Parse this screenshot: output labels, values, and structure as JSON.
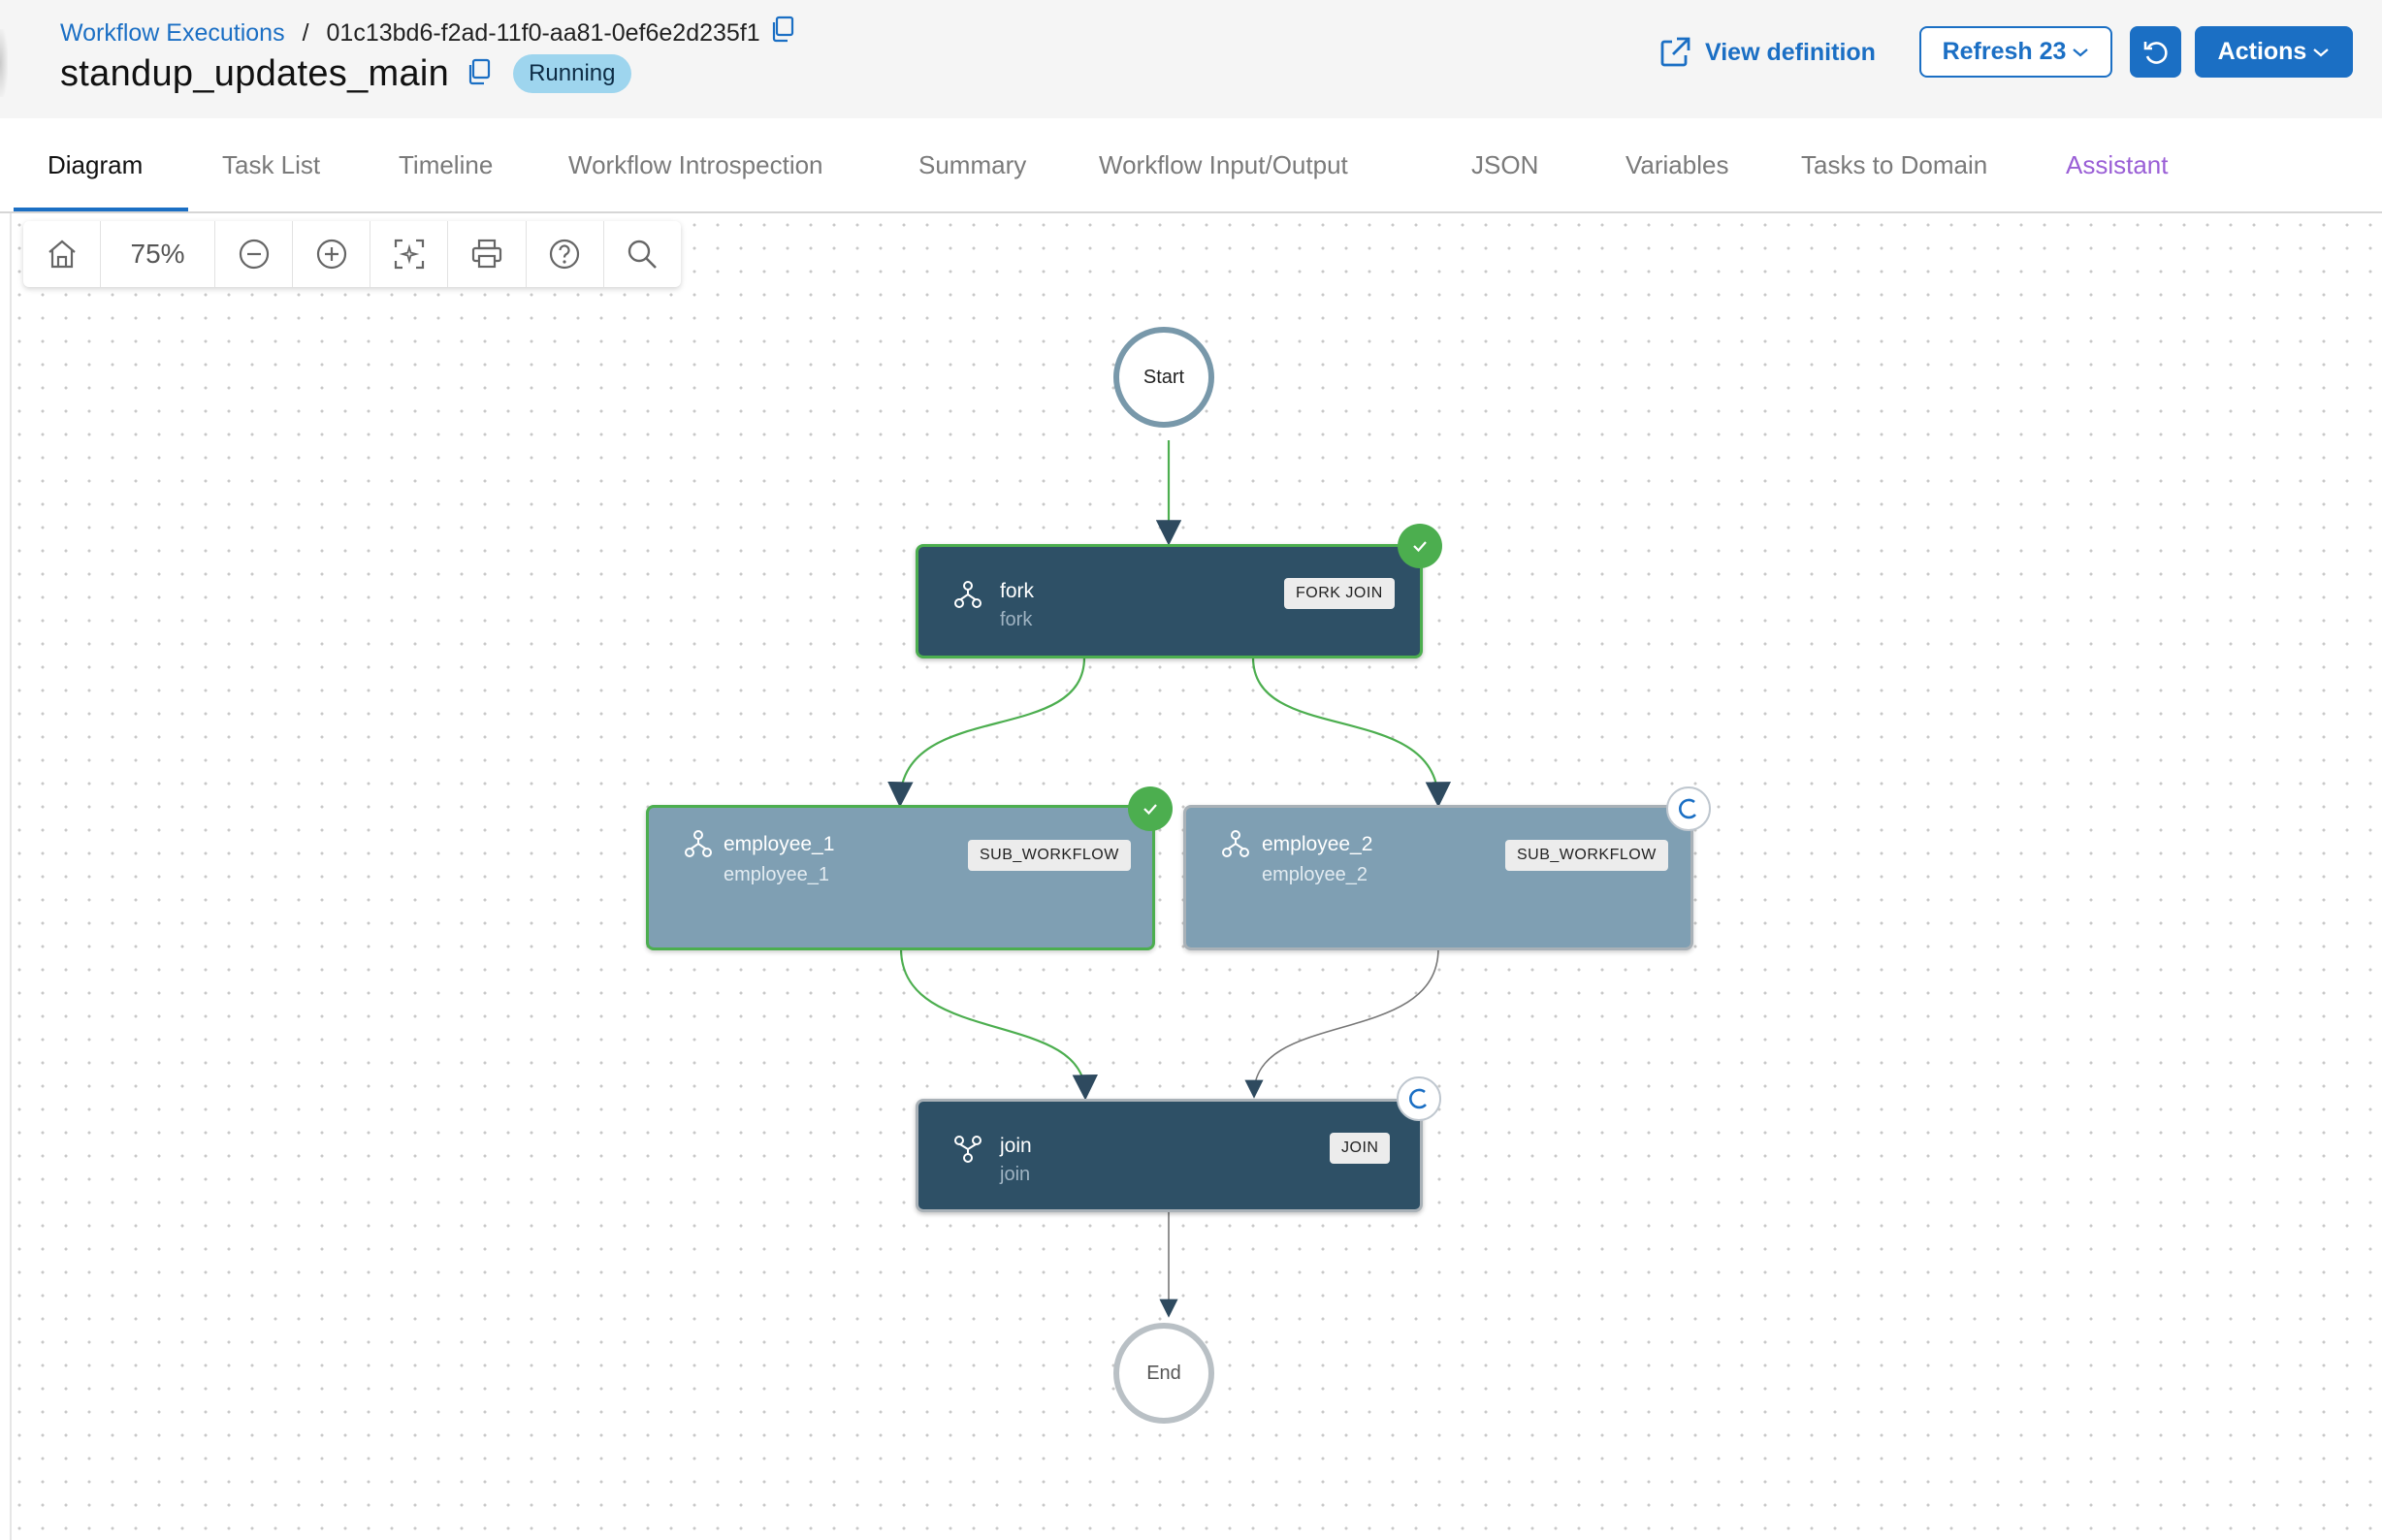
{
  "header": {
    "breadcrumb_link": "Workflow Executions",
    "breadcrumb_separator": "/",
    "execution_id": "01c13bd6-f2ad-11f0-aa81-0ef6e2d235f1",
    "title": "standup_updates_main",
    "status": "Running",
    "view_definition": "View definition",
    "refresh_label": "Refresh 23",
    "actions_label": "Actions"
  },
  "tabs": [
    {
      "label": "Diagram",
      "active": true
    },
    {
      "label": "Task List"
    },
    {
      "label": "Timeline"
    },
    {
      "label": "Workflow Introspection"
    },
    {
      "label": "Summary"
    },
    {
      "label": "Workflow Input/Output"
    },
    {
      "label": "JSON"
    },
    {
      "label": "Variables"
    },
    {
      "label": "Tasks to Domain"
    },
    {
      "label": "Assistant"
    }
  ],
  "toolbar": {
    "zoom": "75%",
    "icons": [
      "home-icon",
      "zoom-out-icon",
      "zoom-in-icon",
      "fit-view-icon",
      "print-icon",
      "help-icon",
      "search-icon"
    ]
  },
  "diagram": {
    "start_label": "Start",
    "end_label": "End",
    "nodes": [
      {
        "name": "fork",
        "ref": "fork",
        "type": "FORK JOIN",
        "status": "completed"
      },
      {
        "name": "employee_1",
        "ref": "employee_1",
        "type": "SUB_WORKFLOW",
        "status": "completed"
      },
      {
        "name": "employee_2",
        "ref": "employee_2",
        "type": "SUB_WORKFLOW",
        "status": "in-progress"
      },
      {
        "name": "join",
        "ref": "join",
        "type": "JOIN",
        "status": "in-progress"
      }
    ]
  },
  "colors": {
    "accent": "#1b6fc4",
    "success": "#4cae4f",
    "node_dark": "#2e5066",
    "node_light": "#7f9fb3",
    "badge_running": "#9ed5ee",
    "assistant_tab": "#9a5fd6"
  }
}
